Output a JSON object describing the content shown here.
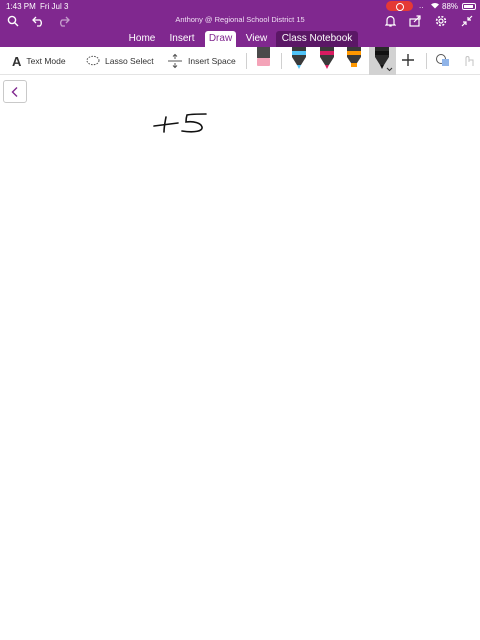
{
  "status_bar": {
    "time": "1:43 PM",
    "date": "Fri Jul 3",
    "battery": "88%"
  },
  "header": {
    "account": "Anthony @ Regional School District 15",
    "icons": [
      "search-icon",
      "undo-icon",
      "redo-icon",
      "bell-icon",
      "share-icon",
      "gear-icon",
      "collapse-icon"
    ]
  },
  "tabs": [
    {
      "label": "Home"
    },
    {
      "label": "Insert"
    },
    {
      "label": "Draw",
      "active": true
    },
    {
      "label": "View"
    },
    {
      "label": "Class Notebook"
    }
  ],
  "ribbon": {
    "text_mode": "Text Mode",
    "lasso_select": "Lasso Select",
    "insert_space": "Insert Space",
    "pens": [
      {
        "name": "eraser",
        "color": "#f4a3b8"
      },
      {
        "name": "pen-blue",
        "color": "#4fc3f7"
      },
      {
        "name": "pen-magenta",
        "color": "#d81b60"
      },
      {
        "name": "highlighter-orange",
        "color": "#ff9800"
      },
      {
        "name": "pen-black",
        "color": "#222222",
        "selected": true
      }
    ]
  },
  "colors": {
    "accent": "#80288f",
    "notebook_tab": "#5b1766",
    "recording": "#e53935"
  },
  "canvas": {
    "ink": "+5"
  }
}
